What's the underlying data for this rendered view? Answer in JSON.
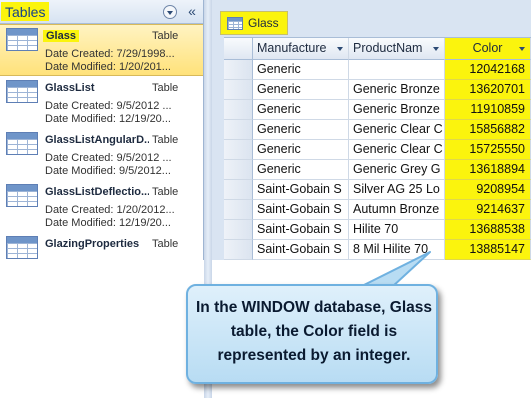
{
  "nav": {
    "title": "Tables",
    "items": [
      {
        "name": "Glass",
        "type": "Table",
        "created": "Date Created: 7/29/1998...",
        "modified": "Date Modified: 1/20/201..."
      },
      {
        "name": "GlassList",
        "type": "Table",
        "created": "Date Created: 9/5/2012 ...",
        "modified": "Date Modified: 12/19/20..."
      },
      {
        "name": "GlassListAngularD...",
        "type": "Table",
        "created": "Date Created: 9/5/2012 ...",
        "modified": "Date Modified: 9/5/2012..."
      },
      {
        "name": "GlassListDeflectio...",
        "type": "Table",
        "created": "Date Created: 1/20/2012...",
        "modified": "Date Modified: 12/19/20..."
      },
      {
        "name": "GlazingProperties",
        "type": "Table",
        "created": "",
        "modified": ""
      }
    ]
  },
  "datasheet": {
    "tab_label": "Glass",
    "columns": [
      "Manufacture",
      "ProductNam",
      "Color"
    ],
    "rows": [
      [
        "Generic",
        "",
        "12042168"
      ],
      [
        "Generic",
        "Generic Bronze",
        "13620701"
      ],
      [
        "Generic",
        "Generic Bronze",
        "11910859"
      ],
      [
        "Generic",
        "Generic Clear C",
        "15856882"
      ],
      [
        "Generic",
        "Generic Clear C",
        "15725550"
      ],
      [
        "Generic",
        "Generic Grey G",
        "13618894"
      ],
      [
        "Saint-Gobain S",
        "Silver AG 25 Lo",
        "9208954"
      ],
      [
        "Saint-Gobain S",
        "Autumn Bronze",
        "9214637"
      ],
      [
        "Saint-Gobain S",
        "Hilite 70",
        "13688538"
      ],
      [
        "Saint-Gobain S",
        "8 Mil Hilite 70",
        "13885147"
      ]
    ]
  },
  "callout": {
    "text": "In the WINDOW database, Glass table, the Color field is represented by an integer."
  },
  "colors": {
    "highlight": "#fbf40d",
    "callout_fill": "#c9e6f8",
    "callout_border": "#6fb1e0"
  }
}
